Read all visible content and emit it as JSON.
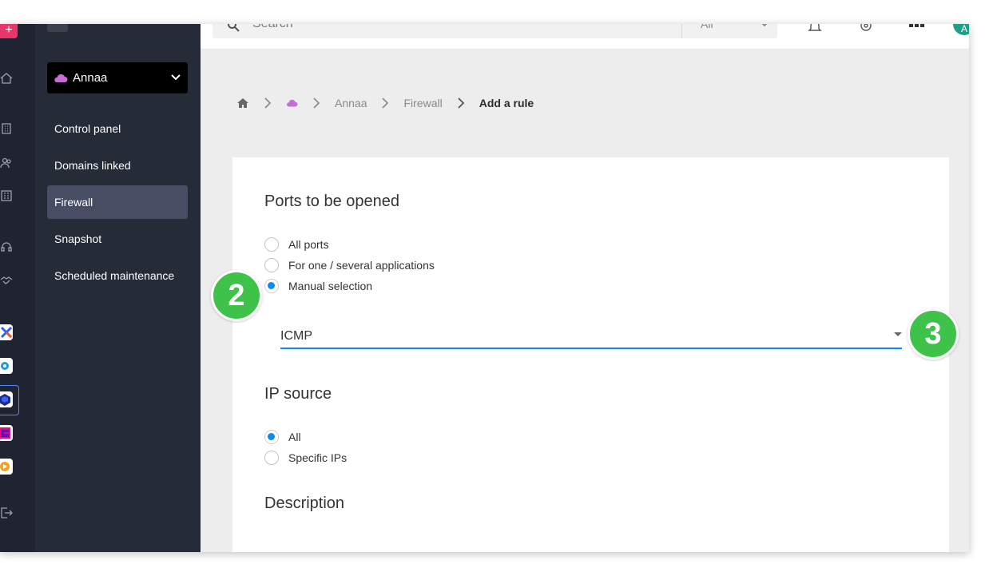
{
  "colors": {
    "accent": "#0a8cf0",
    "badge": "#3fc24a",
    "sidebar": "#262b38",
    "rail": "#1f2430",
    "brand_pink": "#e9356c",
    "cloud": "#c86dd7"
  },
  "rail": {
    "add_label": "+",
    "icons": [
      "home-icon",
      "building-icon",
      "users-icon",
      "office-icon",
      "headset-icon",
      "handshake-icon",
      "logout-icon"
    ],
    "apps": [
      "kchat-app-icon",
      "kdrive-app-icon",
      "cloud-app-icon",
      "mail-app-icon",
      "swisstransfer-app-icon"
    ]
  },
  "sidebar": {
    "server_name": "Annaa",
    "items": [
      {
        "label": "Control panel"
      },
      {
        "label": "Domains linked"
      },
      {
        "label": "Firewall"
      },
      {
        "label": "Snapshot"
      },
      {
        "label": "Scheduled maintenance"
      }
    ]
  },
  "topbar": {
    "search_placeholder": "Search",
    "search_scope": "All",
    "icons": [
      "bell-icon",
      "gear-icon",
      "grid-icon"
    ],
    "avatar_initial": "A"
  },
  "breadcrumb": {
    "items": [
      "Annaa",
      "Firewall"
    ],
    "current": "Add a rule"
  },
  "form": {
    "ports_title": "Ports to be opened",
    "ports_options": [
      {
        "label": "All ports",
        "checked": false
      },
      {
        "label": "For one / several applications",
        "checked": false
      },
      {
        "label": "Manual selection",
        "checked": true
      }
    ],
    "protocol_value": "ICMP",
    "ip_title": "IP source",
    "ip_options": [
      {
        "label": "All",
        "checked": true
      },
      {
        "label": "Specific IPs",
        "checked": false
      }
    ],
    "description_title": "Description"
  },
  "callouts": [
    "2",
    "3"
  ]
}
